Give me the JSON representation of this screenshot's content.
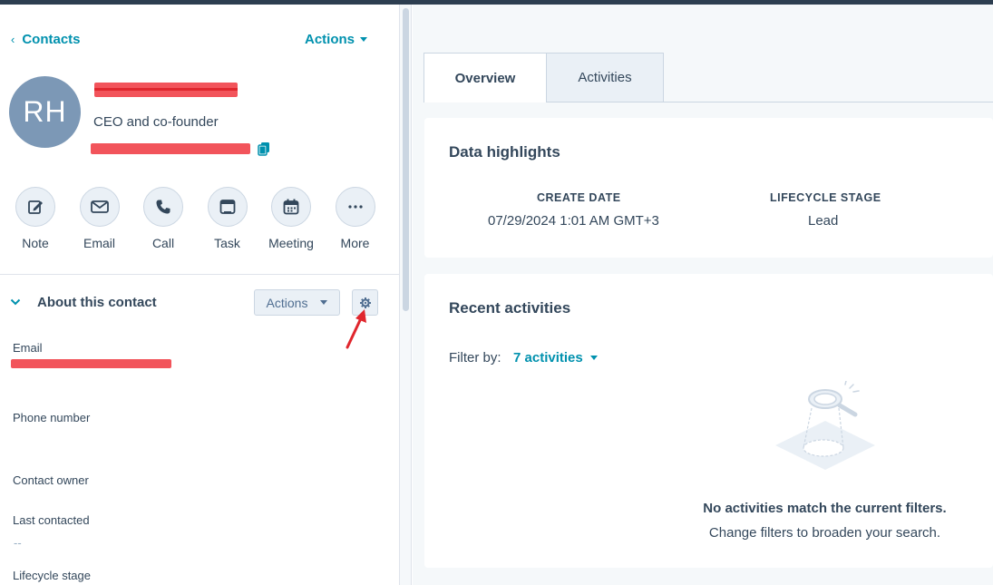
{
  "header": {
    "back_label": "Contacts",
    "actions_label": "Actions"
  },
  "contact": {
    "initials": "RH",
    "job_title": "CEO and co-founder"
  },
  "quick_actions": [
    {
      "label": "Note",
      "icon": "note-icon"
    },
    {
      "label": "Email",
      "icon": "email-icon"
    },
    {
      "label": "Call",
      "icon": "phone-icon"
    },
    {
      "label": "Task",
      "icon": "task-icon"
    },
    {
      "label": "Meeting",
      "icon": "calendar-icon"
    },
    {
      "label": "More",
      "icon": "more-icon"
    }
  ],
  "about": {
    "title": "About this contact",
    "actions_label": "Actions",
    "properties": {
      "email_label": "Email",
      "phone_label": "Phone number",
      "owner_label": "Contact owner",
      "last_contacted_label": "Last contacted",
      "last_contacted_value": "--",
      "lifecycle_label": "Lifecycle stage"
    }
  },
  "tabs": {
    "overview": "Overview",
    "activities": "Activities"
  },
  "highlights": {
    "title": "Data highlights",
    "create_date_label": "CREATE DATE",
    "create_date_value": "07/29/2024 1:01 AM GMT+3",
    "lifecycle_label": "LIFECYCLE STAGE",
    "lifecycle_value": "Lead"
  },
  "recent": {
    "title": "Recent activities",
    "filter_label": "Filter by:",
    "filter_value": "7 activities",
    "empty_title": "No activities match the current filters.",
    "empty_subtitle": "Change filters to broaden your search."
  },
  "colors": {
    "accent": "#0091ae",
    "text": "#33475b",
    "avatar": "#7c98b6",
    "redaction": "#f2545b"
  }
}
